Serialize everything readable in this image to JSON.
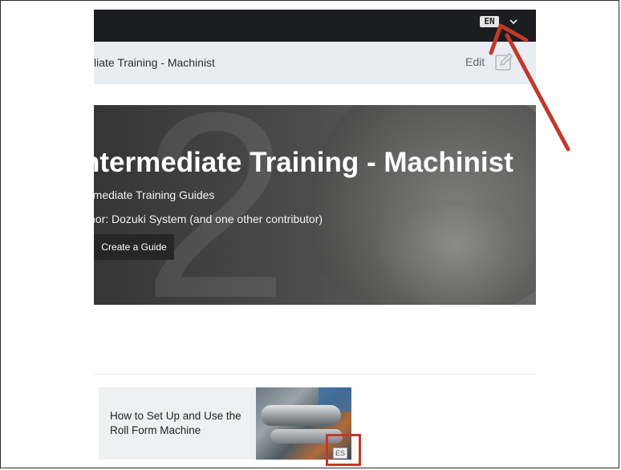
{
  "topbar": {
    "language": "EN"
  },
  "breadcrumb": {
    "title": "liate Training - Machinist",
    "edit_label": "Edit"
  },
  "hero": {
    "big_number": "2",
    "title": "ntermediate Training - Machinist",
    "subtitle": "rmediate Training Guides",
    "author": "hor: Dozuki System (and one other contributor)",
    "create_button": "Create a Guide"
  },
  "guide_card": {
    "title": "How to Set Up and Use the Roll Form Machine",
    "language_badge": "ES"
  },
  "colors": {
    "annotation": "#c0392b",
    "topbar": "#1b1d20",
    "crumbbar": "#e9edf3"
  },
  "icons": [
    "chevron-down-icon",
    "pencil-edit-icon"
  ]
}
